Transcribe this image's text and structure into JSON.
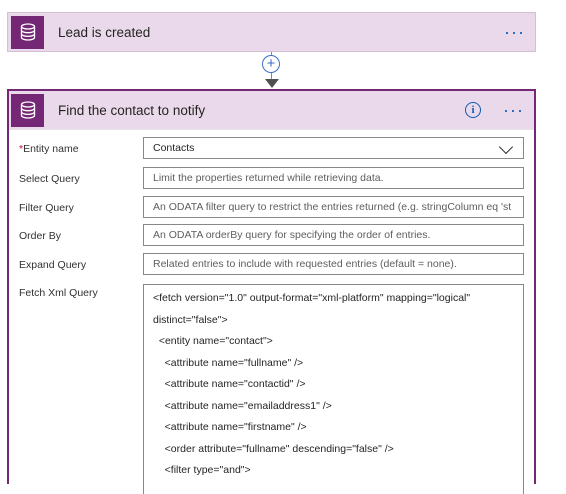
{
  "trigger": {
    "title": "Lead is created",
    "icon": "database-icon",
    "more_label": "···"
  },
  "connector": {
    "add_label": "+"
  },
  "action": {
    "title": "Find the contact to notify",
    "icon": "database-icon",
    "info_label": "i",
    "more_label": "···",
    "fields": {
      "entity_name": {
        "label": "Entity name",
        "required_mark": "*",
        "value": "Contacts"
      },
      "select_query": {
        "label": "Select Query",
        "placeholder": "Limit the properties returned while retrieving data."
      },
      "filter_query": {
        "label": "Filter Query",
        "placeholder": "An ODATA filter query to restrict the entries returned (e.g. stringColumn eq 'st"
      },
      "order_by": {
        "label": "Order By",
        "placeholder": "An ODATA orderBy query for specifying the order of entries."
      },
      "expand_query": {
        "label": "Expand Query",
        "placeholder": "Related entries to include with requested entries (default = none)."
      },
      "fetch_xml": {
        "label": "Fetch Xml Query",
        "lines": [
          "<fetch version=\"1.0\" output-format=\"xml-platform\" mapping=\"logical\"",
          "distinct=\"false\">",
          "  <entity name=\"contact\">",
          "    <attribute name=\"fullname\" />",
          "    <attribute name=\"contactid\" />",
          "    <attribute name=\"emailaddress1\" />",
          "    <attribute name=\"firstname\" />",
          "    <order attribute=\"fullname\" descending=\"false\" />",
          "    <filter type=\"and\">"
        ]
      }
    }
  },
  "colors": {
    "accent": "#742774",
    "header_bg": "#ead9ea",
    "link": "#0f5bb5"
  }
}
